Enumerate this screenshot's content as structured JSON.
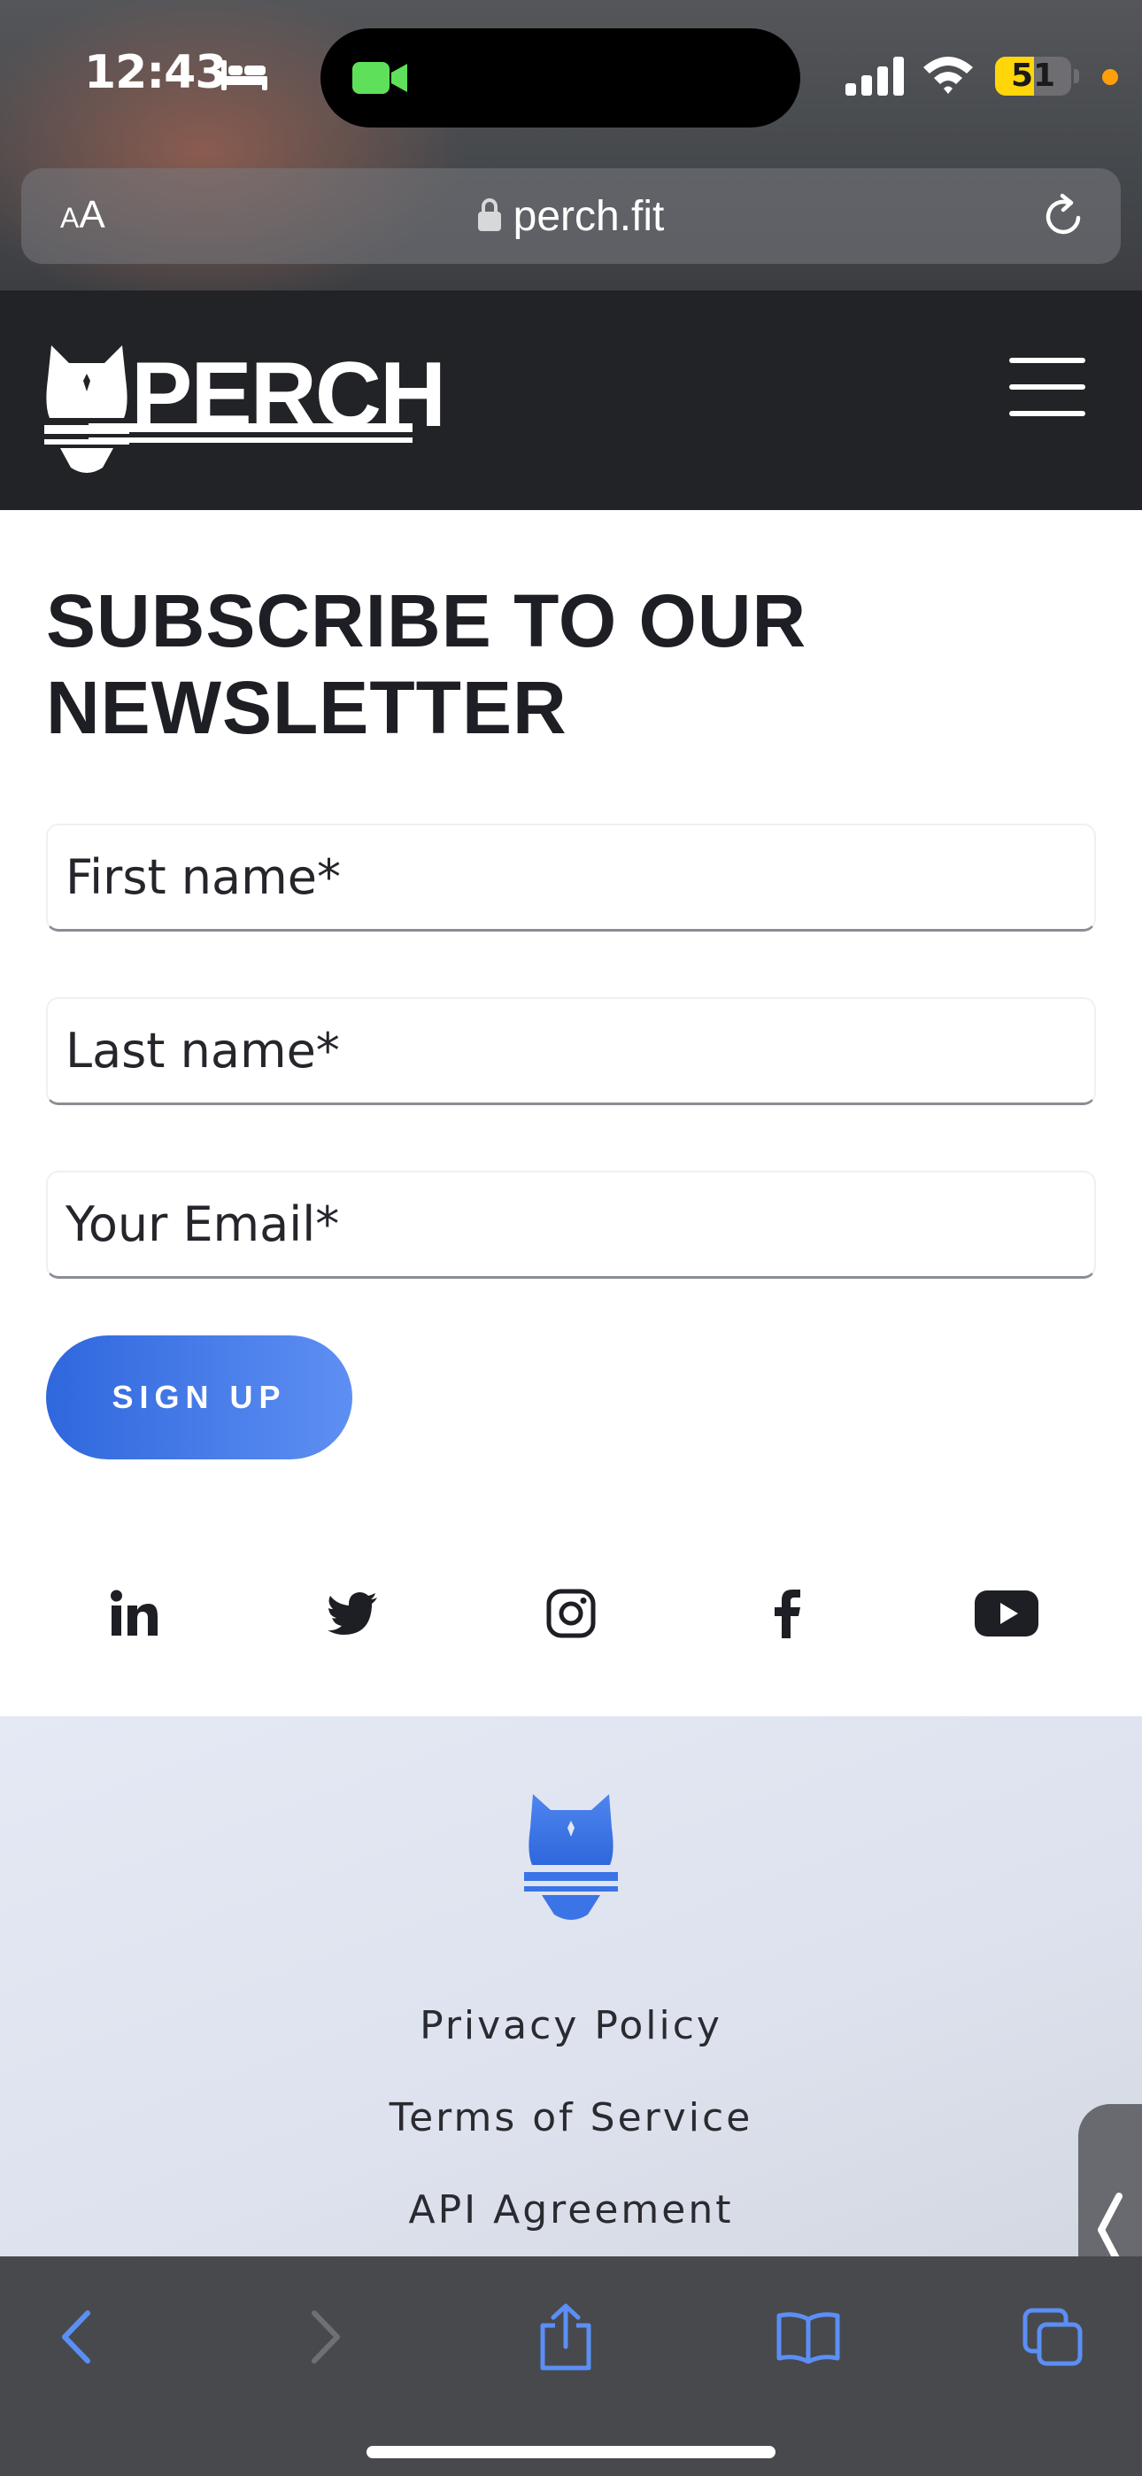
{
  "status_bar": {
    "time": "12:43",
    "battery_level": "51",
    "battery_fraction": 0.51,
    "icons": [
      "bed-icon",
      "facetime-icon",
      "signal-icon",
      "wifi-icon",
      "battery-icon"
    ]
  },
  "browser": {
    "text_size_label_small": "A",
    "text_size_label_large": "A",
    "url": "perch.fit"
  },
  "header": {
    "logo_text": "PERCH"
  },
  "newsletter": {
    "title": "SUBSCRIBE TO OUR NEWSLETTER",
    "first_name_placeholder": "First name*",
    "last_name_placeholder": "Last name*",
    "email_placeholder": "Your Email*",
    "signup_label": "SIGN UP"
  },
  "social": [
    "linkedin-icon",
    "twitter-icon",
    "instagram-icon",
    "facebook-icon",
    "youtube-icon"
  ],
  "footer": {
    "links": [
      "Privacy Policy",
      "Terms of Service",
      "API Agreement"
    ]
  },
  "colors": {
    "header_bg": "#222327",
    "accent_blue": "#3a74e6",
    "footer_bg": "#e1e6f0",
    "toolbar_icon": "#5b8ff5"
  }
}
